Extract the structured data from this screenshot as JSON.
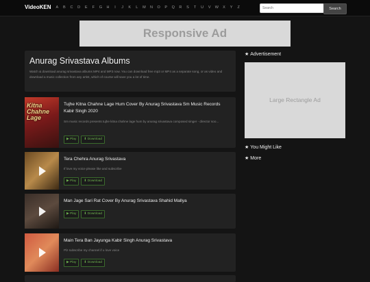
{
  "brand": "VideoKEN",
  "alphabet": [
    "A",
    "B",
    "C",
    "D",
    "E",
    "F",
    "G",
    "H",
    "I",
    "J",
    "K",
    "L",
    "M",
    "N",
    "O",
    "P",
    "Q",
    "R",
    "S",
    "T",
    "U",
    "V",
    "W",
    "X",
    "Y",
    "Z"
  ],
  "search": {
    "placeholder": "Search",
    "button": "Search"
  },
  "ad_top": "Responsive Ad",
  "header": {
    "title": "Anurag Srivastava Albums",
    "description": "Watch & download anurag srivastava albums MP4 and MP3 now. You can download free mp3 or MP4 as a separate song, or as video and download a music collection from any artist, which of course will save you a lot of time."
  },
  "videos": [
    {
      "title": "Tujhe Kitna Chahne Lage Hum Cover By Anurag Srivastava Sm Music Records Kabir Singh 2020",
      "description": "Sm music records presents tujhe kitna chahne lage hum by anurag srivastava composed singer - director soo...",
      "thumb_text": "Kitna Chahne Lage",
      "play": "▶ Play",
      "download": "⬇ Download"
    },
    {
      "title": "Tera Chehra Anurag Srivastava",
      "description": "If love my voice please like and subscribe",
      "play": "▶ Play",
      "download": "⬇ Download"
    },
    {
      "title": "Man Jage Sari Rat Cover By Anurag Srivastava Shahid Mallya",
      "description": "",
      "play": "▶ Play",
      "download": "⬇ Download"
    },
    {
      "title": "Main Tera Ban Jayunga Kabir Singh Anurag Srivastava",
      "description": "Plz subscribe my channel if u love voice",
      "play": "▶ Play",
      "download": "⬇ Download"
    }
  ],
  "sidebar": {
    "advertisement": "Advertisement",
    "ad_label": "Large Rectangle Ad",
    "you_might_like": "You Might Like",
    "more": "More"
  }
}
